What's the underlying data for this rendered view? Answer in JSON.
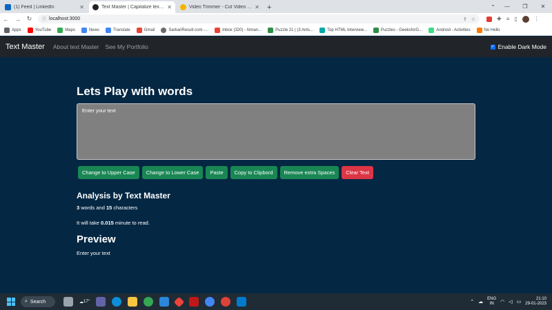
{
  "browser": {
    "tabs": [
      {
        "label": "(1) Feed | LinkedIn",
        "icon": "linkedin-icon",
        "color": "#0a66c2"
      },
      {
        "label": "Text Master | Capitalize text | Re",
        "icon": "react-icon",
        "color": "#222222"
      },
      {
        "label": "Video Trimmer - Cut Video Onli",
        "icon": "video-trimmer-icon",
        "color": "#f4b400"
      }
    ],
    "url": "localhost:3000",
    "bookmarks": [
      {
        "label": "Apps",
        "color": "#5f6368"
      },
      {
        "label": "YouTube",
        "color": "#ff0000"
      },
      {
        "label": "Maps",
        "color": "#34a853"
      },
      {
        "label": "News",
        "color": "#4285f4"
      },
      {
        "label": "Translate",
        "color": "#4285f4"
      },
      {
        "label": "Gmail",
        "color": "#ea4335"
      },
      {
        "label": "SarkariResult.com -...",
        "color": "#6b6b6b"
      },
      {
        "label": "Inbox (320) - himan...",
        "color": "#ea4335"
      },
      {
        "label": "Puzzle 21 | (3 Ants...",
        "color": "#2f8d46"
      },
      {
        "label": "Top HTML Interview...",
        "color": "#00a8a8"
      },
      {
        "label": "Puzzles - GeeksforG...",
        "color": "#2f8d46"
      },
      {
        "label": "Android - Activities",
        "color": "#3ddc84"
      },
      {
        "label": "No Hello",
        "color": "#ff7a00"
      }
    ]
  },
  "app": {
    "brand": "Text Master",
    "nav_links": [
      "About text Master",
      "See My Portfolio"
    ],
    "dark_mode_label": "Enable Dark Mode",
    "dark_mode_checked": true,
    "heading": "Lets Play with words",
    "textarea_placeholder": "Enter your text",
    "buttons": {
      "upper": "Change to Upper Case",
      "lower": "Change to Lower Case",
      "paste": "Paste",
      "copy": "Copy to Clipbord",
      "remove_spaces": "Remove extra Spaces",
      "clear": "Clear Text"
    },
    "analysis": {
      "heading": "Analysis by Text Master",
      "word_count": "3",
      "words_and": " words and ",
      "char_count": "15",
      "characters": " characters",
      "read_prefix": "It will take ",
      "read_time": "0.015",
      "read_suffix": " minute to read."
    },
    "preview": {
      "heading": "Preview",
      "text": "Enter your text"
    },
    "colors": {
      "background": "#042743",
      "navbar": "#212529",
      "success": "#198754",
      "danger": "#dc3545"
    }
  },
  "taskbar": {
    "search_label": "Search",
    "weather": "17°",
    "language": "ENG",
    "language_sub": "IN",
    "time": "21:10",
    "date": "29-01-2023"
  }
}
